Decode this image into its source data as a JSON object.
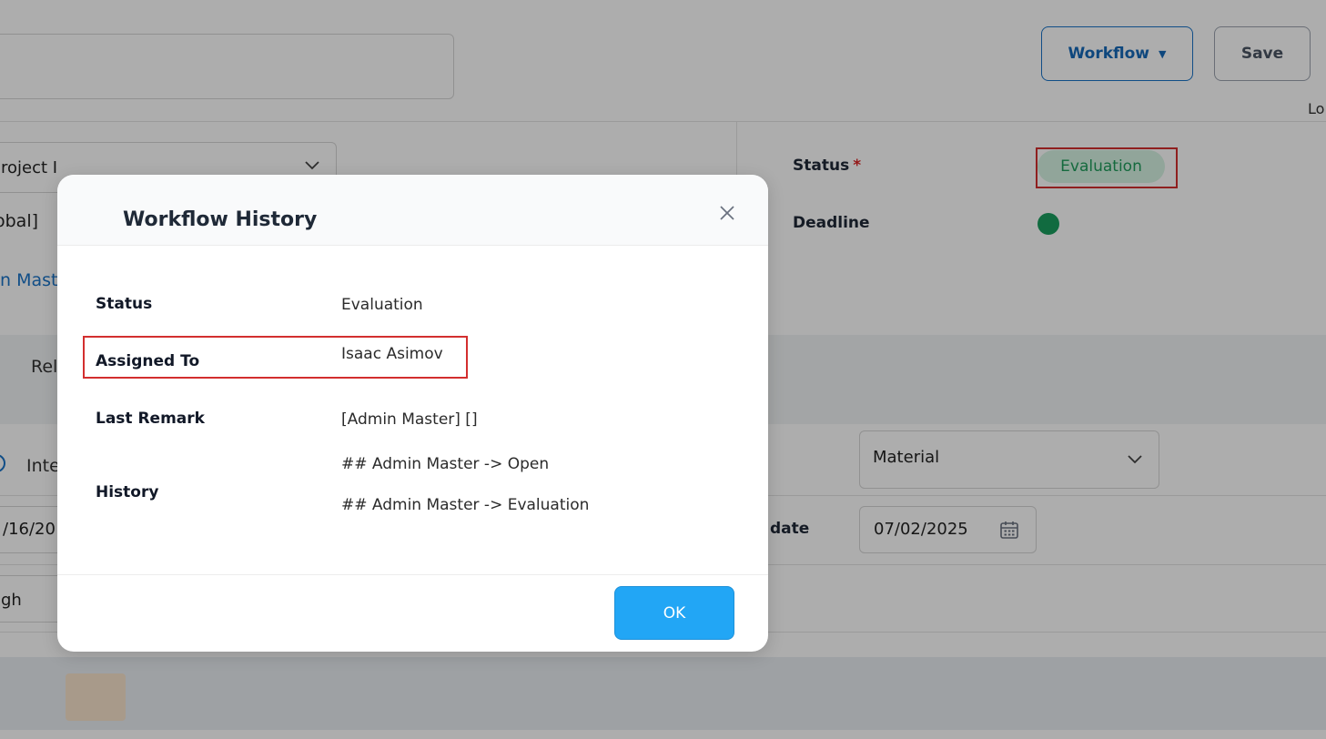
{
  "header": {
    "workflow_button": "Workflow",
    "save_button": "Save",
    "truncated_right_text": "Lo"
  },
  "form": {
    "project_select_value": "roject I",
    "global_text": "obal]",
    "master_link_text": "n Mast",
    "status_label": "Status",
    "status_required_mark": "*",
    "status_value": "Evaluation",
    "deadline_label": "Deadline",
    "tab_partial": "Rel",
    "radio_option_partial": "Inte",
    "material_select_value": "Material",
    "left_date_partial": "/16/20",
    "date_label_partial": "date",
    "date_value": "07/02/2025",
    "priority_partial": "gh"
  },
  "modal": {
    "title": "Workflow History",
    "rows": {
      "status": {
        "label": "Status",
        "value": "Evaluation"
      },
      "assigned_to": {
        "label": "Assigned To",
        "value": "Isaac Asimov"
      },
      "last_remark": {
        "label": "Last Remark",
        "value": "[Admin Master] []"
      },
      "history": {
        "label": "History",
        "entries": [
          "## Admin Master -> Open",
          "## Admin Master -> Evaluation"
        ]
      }
    },
    "ok_button": "OK"
  },
  "colors": {
    "accent_blue": "#1a73c8",
    "ok_button": "#22a6f5",
    "status_green": "#1f9d5c",
    "status_pill_bg": "#d6f3e3",
    "highlight_red": "#d32f2f",
    "required_red": "#dc2626",
    "deadline_dot": "#1a9e5f"
  },
  "icons": {
    "workflow_caret": "caret-down-icon",
    "close": "close-icon",
    "select_chevron": "chevron-down-icon",
    "calendar": "calendar-icon"
  }
}
